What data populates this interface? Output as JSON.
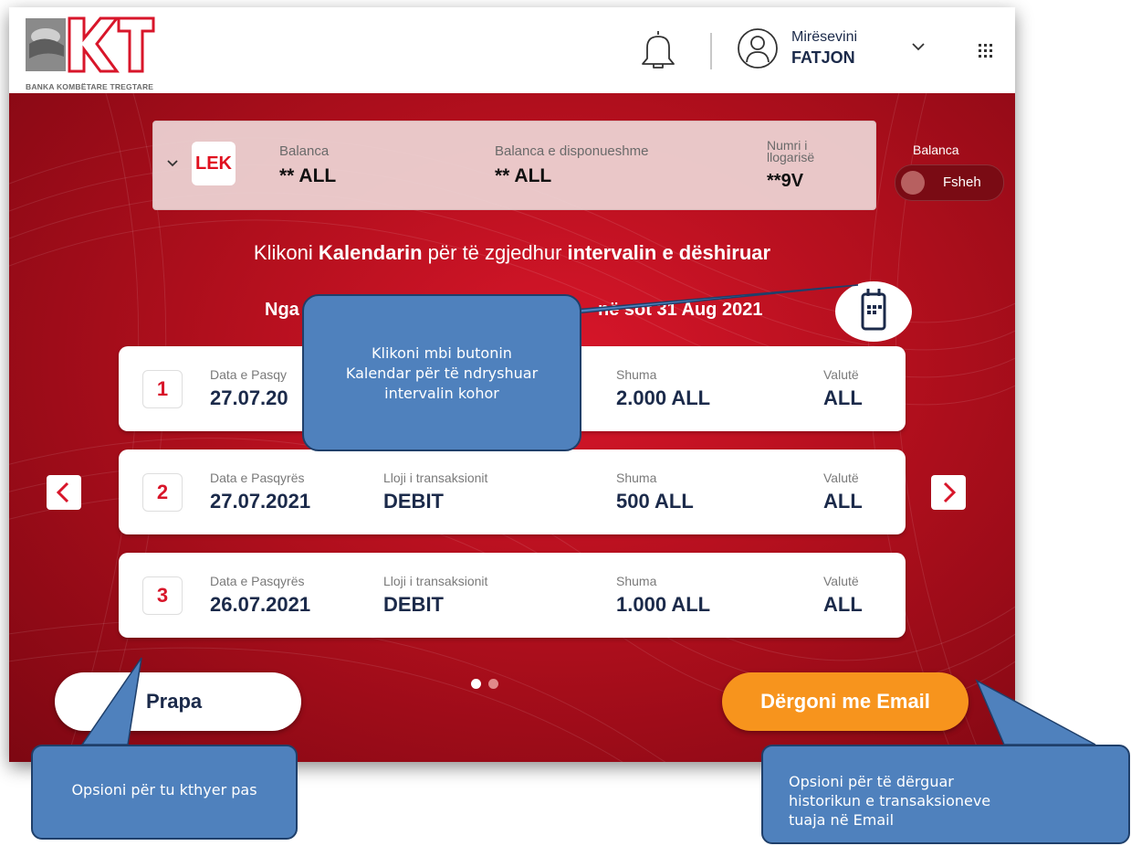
{
  "header": {
    "logo_text": "BKT",
    "logo_subtitle": "BANKA KOMBËTARE TREGTARE",
    "welcome": "Mirësevini",
    "username": "FATJON"
  },
  "balance_bar": {
    "currency_badge": "LEK",
    "balance_label": "Balanca",
    "balance_value": "** ALL",
    "available_label": "Balanca e disponueshme",
    "available_value": "** ALL",
    "account_label_line1": "Numri i",
    "account_label_line2": "llogarisë",
    "account_value": "**9V"
  },
  "toggle": {
    "label": "Balanca",
    "state_text": "Fsheh"
  },
  "instruction": {
    "prefix": "Klikoni ",
    "bold1": "Kalendarin",
    "middle": " për të zgjedhur ",
    "bold2": "intervalin e dëshiruar"
  },
  "range": {
    "left": "Nga",
    "right": "në sot 31 Aug 2021"
  },
  "columns": {
    "date": "Data e Pasqyrës",
    "type": "Lloji i transaksionit",
    "amount": "Shuma",
    "currency": "Valutë"
  },
  "rows": [
    {
      "num": "1",
      "date": "27.07.20",
      "type": "",
      "amount": "2.000 ALL",
      "currency": "ALL"
    },
    {
      "num": "2",
      "date": "27.07.2021",
      "type": "DEBIT",
      "amount": "500 ALL",
      "currency": "ALL"
    },
    {
      "num": "3",
      "date": "26.07.2021",
      "type": "DEBIT",
      "amount": "1.000 ALL",
      "currency": "ALL"
    }
  ],
  "row1_date_label": "Data e Pasqy",
  "buttons": {
    "back": "Prapa",
    "email": "Dërgoni me Email"
  },
  "pagination": {
    "active_page": 1,
    "total_pages": 2
  },
  "callouts": {
    "calendar_line1": "Klikoni mbi butonin",
    "calendar_line2": "Kalendar për të ndryshuar",
    "calendar_line3": "intervalin kohor",
    "back": "Opsioni për tu kthyer pas",
    "email_line1": "Opsioni për të dërguar",
    "email_line2": "historikun e transaksioneve",
    "email_line3": "tuaja në Email"
  },
  "colors": {
    "brand_red": "#d8162a",
    "accent_orange": "#f7941d",
    "navy": "#1b2a4a",
    "callout_blue": "#4f81bd"
  }
}
